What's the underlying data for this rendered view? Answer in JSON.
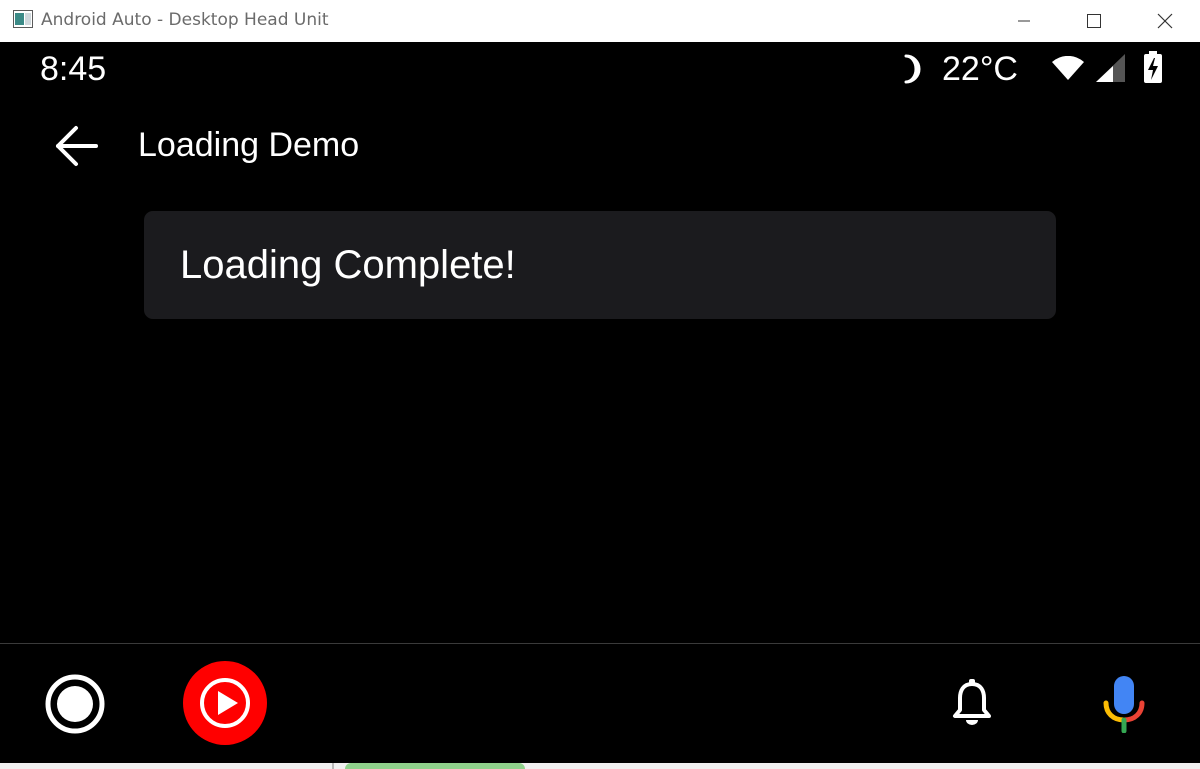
{
  "window": {
    "title": "Android Auto - Desktop Head Unit"
  },
  "statusbar": {
    "time": "8:45",
    "temperature": "22°C",
    "icons": [
      "moon-icon",
      "wifi-icon",
      "cellular-signal-icon",
      "battery-icon"
    ]
  },
  "header": {
    "title": "Loading Demo",
    "back_icon": "arrow-left-icon"
  },
  "card": {
    "message": "Loading Complete!"
  },
  "rail": {
    "items": [
      {
        "name": "home",
        "icon": "home-circle-icon"
      },
      {
        "name": "youtube-music",
        "icon": "youtube-music-icon"
      },
      {
        "name": "notifications",
        "icon": "bell-icon"
      },
      {
        "name": "voice-assistant",
        "icon": "microphone-icon"
      }
    ]
  },
  "colors": {
    "background": "#000000",
    "card": "#1b1b1e",
    "youtube_red": "#ff0000",
    "mic_blue": "#4285f4",
    "mic_red": "#ea4335",
    "mic_yellow": "#fbbc04",
    "mic_green": "#34a853"
  }
}
